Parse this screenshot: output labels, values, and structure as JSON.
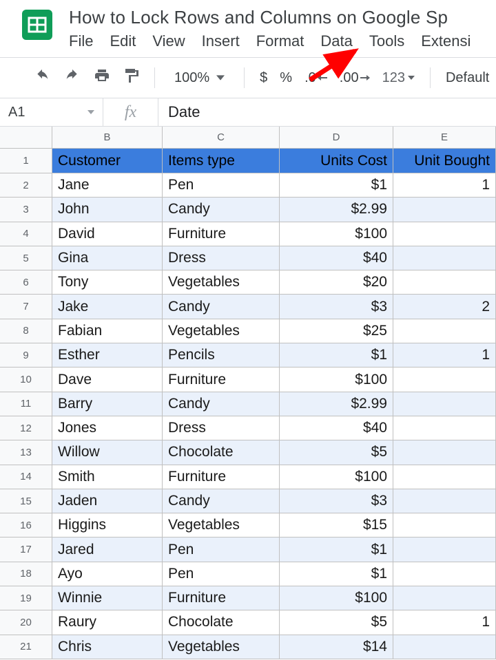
{
  "doc": {
    "title": "How to Lock Rows and Columns on Google Sp"
  },
  "menu": {
    "file": "File",
    "edit": "Edit",
    "view": "View",
    "insert": "Insert",
    "format": "Format",
    "data": "Data",
    "tools": "Tools",
    "extensions": "Extensi"
  },
  "toolbar": {
    "zoom": "100%",
    "currency": "$",
    "percent": "%",
    "dec_less": ".0",
    "dec_more": ".00",
    "num123": "123",
    "font": "Default "
  },
  "fx": {
    "cell_ref": "A1",
    "fx_symbol": "fx",
    "value": "Date"
  },
  "columns": [
    "B",
    "C",
    "D",
    "E"
  ],
  "header_row": {
    "B": "Customer",
    "C": "Items type",
    "D": "Units Cost",
    "E": "Unit Bought"
  },
  "rows": [
    {
      "n": 2,
      "B": "Jane",
      "C": "Pen",
      "D": "$1",
      "E": "1"
    },
    {
      "n": 3,
      "B": "John",
      "C": "Candy",
      "D": "$2.99",
      "E": ""
    },
    {
      "n": 4,
      "B": "David",
      "C": "Furniture",
      "D": "$100",
      "E": ""
    },
    {
      "n": 5,
      "B": "Gina",
      "C": "Dress",
      "D": "$40",
      "E": ""
    },
    {
      "n": 6,
      "B": "Tony",
      "C": "Vegetables",
      "D": "$20",
      "E": ""
    },
    {
      "n": 7,
      "B": "Jake",
      "C": "Candy",
      "D": "$3",
      "E": "2"
    },
    {
      "n": 8,
      "B": "Fabian",
      "C": "Vegetables",
      "D": "$25",
      "E": ""
    },
    {
      "n": 9,
      "B": "Esther",
      "C": "Pencils",
      "D": "$1",
      "E": "1"
    },
    {
      "n": 10,
      "B": "Dave",
      "C": "Furniture",
      "D": "$100",
      "E": ""
    },
    {
      "n": 11,
      "B": "Barry",
      "C": "Candy",
      "D": "$2.99",
      "E": ""
    },
    {
      "n": 12,
      "B": "Jones",
      "C": "Dress",
      "D": "$40",
      "E": ""
    },
    {
      "n": 13,
      "B": "Willow",
      "C": "Chocolate",
      "D": "$5",
      "E": ""
    },
    {
      "n": 14,
      "B": "Smith",
      "C": "Furniture",
      "D": "$100",
      "E": ""
    },
    {
      "n": 15,
      "B": "Jaden",
      "C": "Candy",
      "D": "$3",
      "E": ""
    },
    {
      "n": 16,
      "B": "Higgins",
      "C": "Vegetables",
      "D": "$15",
      "E": ""
    },
    {
      "n": 17,
      "B": "Jared",
      "C": "Pen",
      "D": "$1",
      "E": ""
    },
    {
      "n": 18,
      "B": "Ayo",
      "C": "Pen",
      "D": "$1",
      "E": ""
    },
    {
      "n": 19,
      "B": "Winnie",
      "C": "Furniture",
      "D": "$100",
      "E": ""
    },
    {
      "n": 20,
      "B": "Raury",
      "C": "Chocolate",
      "D": "$5",
      "E": "1"
    },
    {
      "n": 21,
      "B": "Chris",
      "C": "Vegetables",
      "D": "$14",
      "E": ""
    }
  ],
  "colors": {
    "accent": "#3b7ddd",
    "band": "#eaf1fb",
    "arrow": "#ff0000"
  }
}
